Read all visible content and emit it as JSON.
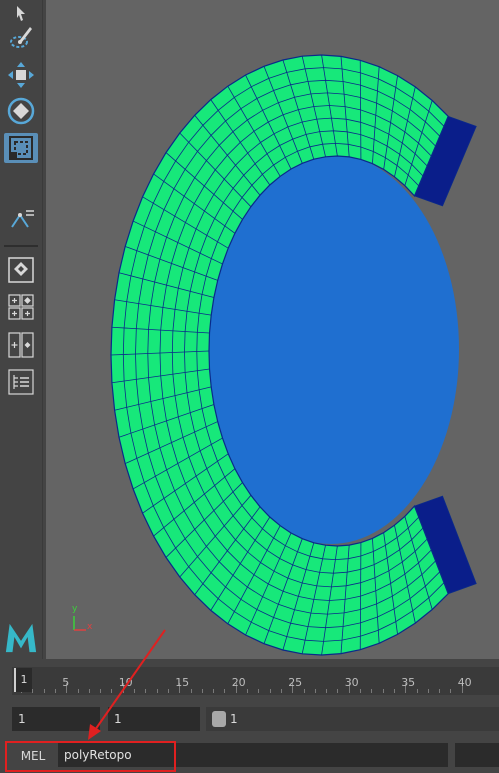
{
  "toolbox": {
    "tools": [
      {
        "name": "select-tool",
        "icon": "arrow-cursor-icon"
      },
      {
        "name": "lasso-paint-tool",
        "icon": "paint-select-icon"
      },
      {
        "name": "move-tool",
        "icon": "move-arrows-icon"
      },
      {
        "name": "rotate-tool",
        "icon": "rotate-icon"
      },
      {
        "name": "scale-tool",
        "icon": "scale-box-icon",
        "active": true
      },
      {
        "name": "snap-settings-tool",
        "icon": "snap-icon"
      },
      {
        "name": "layout-single",
        "icon": "single-pane-icon"
      },
      {
        "name": "layout-four",
        "icon": "four-pane-icon"
      },
      {
        "name": "layout-two",
        "icon": "two-pane-icon"
      },
      {
        "name": "outliner",
        "icon": "outliner-icon"
      }
    ],
    "logo": "maya-logo-icon"
  },
  "viewport": {
    "object": "C letter mesh",
    "mesh_color": "#17e87a",
    "wire_color": "#0a2a8a",
    "background": "#646464",
    "axis_labels": [
      "y",
      "x"
    ]
  },
  "timeline": {
    "current_frame": "1",
    "ticks": [
      "5",
      "10",
      "15",
      "20",
      "25",
      "30",
      "35",
      "40"
    ]
  },
  "range": {
    "start_field": "1",
    "playback_start_field": "1",
    "slider_value": "1"
  },
  "command_line": {
    "language_label": "MEL",
    "input_value": "polyRetopo"
  },
  "colors": {
    "highlight": "#e02020"
  }
}
